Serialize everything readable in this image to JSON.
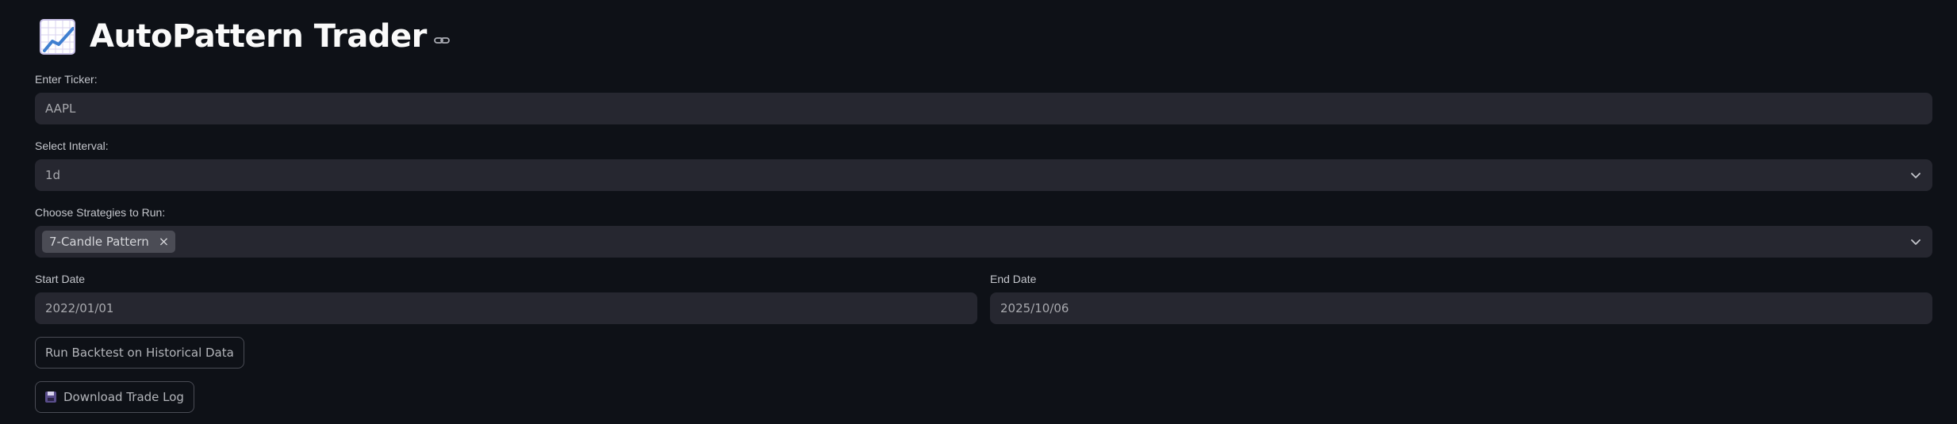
{
  "header": {
    "title": "AutoPattern Trader",
    "emoji_icon": "chart-increasing-icon",
    "anchor_icon": "link-icon"
  },
  "ticker": {
    "label": "Enter Ticker:",
    "value": "AAPL"
  },
  "interval": {
    "label": "Select Interval:",
    "selected": "1d"
  },
  "strategies": {
    "label": "Choose Strategies to Run:",
    "selected_tags": [
      "7-Candle Pattern"
    ],
    "tag_close_glyph": "×"
  },
  "start_date": {
    "label": "Start Date",
    "value": "2022/01/01"
  },
  "end_date": {
    "label": "End Date",
    "value": "2025/10/06"
  },
  "actions": {
    "run_backtest_label": "Run Backtest on Historical Data",
    "download_label": "Download Trade Log",
    "download_icon": "floppy-disk-icon"
  },
  "colors": {
    "background": "#0e1117",
    "input_background": "#262730",
    "tag_background": "#4b4c55"
  }
}
